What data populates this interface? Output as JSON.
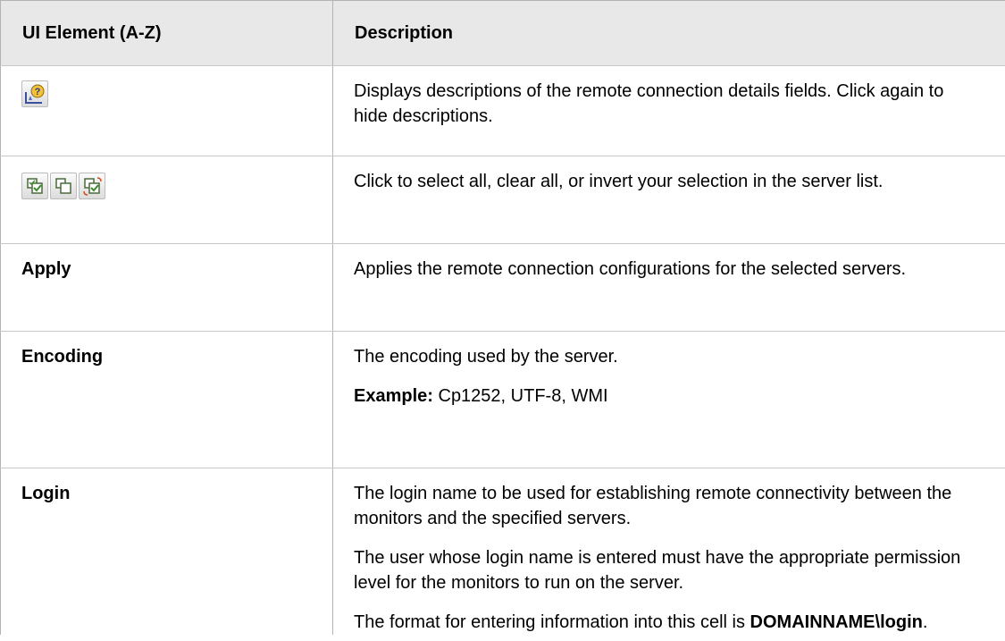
{
  "table": {
    "headers": {
      "col1": "UI Element (A-Z)",
      "col2": "Description"
    },
    "rows": [
      {
        "element_icons": [
          "help-descriptions-icon"
        ],
        "description": [
          "Displays descriptions of the remote connection details fields. Click again to hide descriptions."
        ]
      },
      {
        "element_icons": [
          "select-all-icon",
          "clear-all-icon",
          "invert-selection-icon"
        ],
        "description": [
          "Click to select all, clear all, or invert your selection in the server list."
        ]
      },
      {
        "element": "Apply",
        "description": [
          "Applies the remote connection configurations for the selected servers."
        ]
      },
      {
        "element": "Encoding",
        "description": [
          "The encoding used by the server."
        ],
        "example_label": "Example:",
        "example_text": " Cp1252, UTF-8, WMI"
      },
      {
        "element": "Login",
        "description": [
          "The login name to be used for establishing remote connectivity between the monitors and the specified servers.",
          "The user whose login name is entered must have the appropriate permission level for the monitors to run on the server.",
          "The format for entering information into this cell is "
        ],
        "format_value": "DOMAINNAME\\login",
        "format_suffix": "."
      }
    ]
  }
}
